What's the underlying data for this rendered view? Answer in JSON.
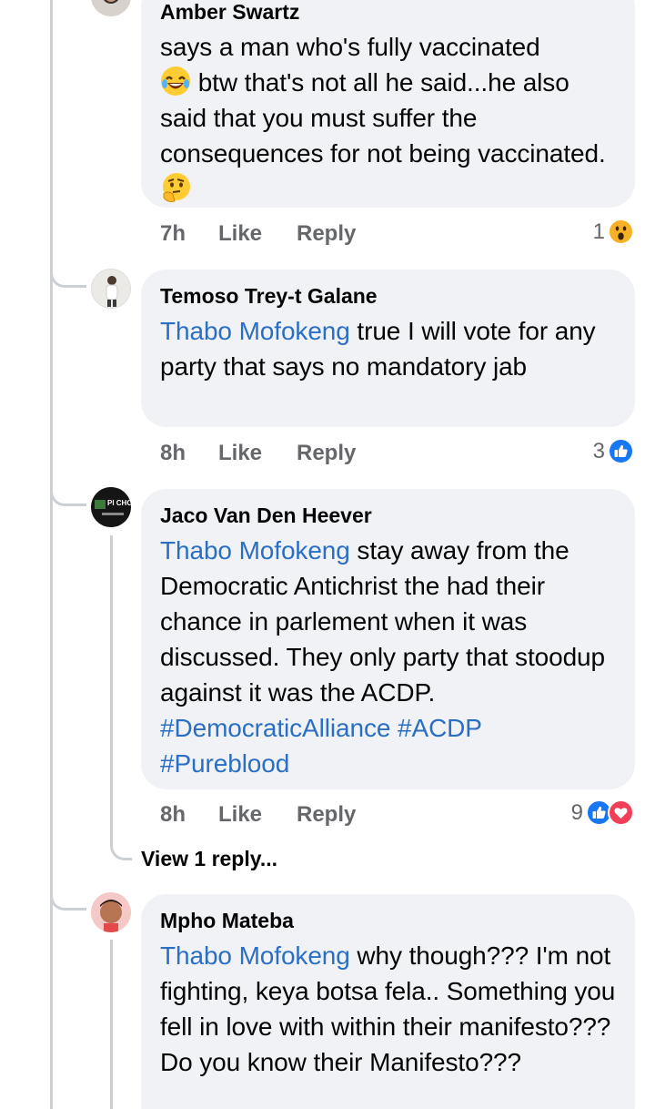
{
  "comments": [
    {
      "author": "Amber Swartz",
      "text_parts": [
        "says a man who's fully vaccinated",
        "btw that's not all he said...he also said that you must suffer the consequences for not being vaccinated."
      ],
      "time": "7h",
      "like_label": "Like",
      "reply_label": "Reply",
      "reaction_count": "1",
      "reactions": [
        "wow-icon"
      ]
    },
    {
      "author": "Temoso Trey-t Galane",
      "mention": "Thabo Mofokeng",
      "text": " true I will vote for any party that says no mandatory jab",
      "time": "8h",
      "like_label": "Like",
      "reply_label": "Reply",
      "reaction_count": "3",
      "reactions": [
        "like-icon"
      ]
    },
    {
      "author": "Jaco Van Den Heever",
      "mention": "Thabo Mofokeng",
      "text": " stay away from the Democratic Antichrist the had their chance in parlement when it was discussed. They only party that stoodup against it was the ACDP.",
      "hashtags": [
        "#DemocraticAlliance",
        "#ACDP",
        "#Pureblood"
      ],
      "time": "8h",
      "like_label": "Like",
      "reply_label": "Reply",
      "reaction_count": "9",
      "reactions": [
        "like-icon",
        "love-icon"
      ],
      "view_replies": "View 1 reply..."
    },
    {
      "author": "Mpho Mateba",
      "mention": "Thabo Mofokeng",
      "text": " why though??? I'm not fighting, keya botsa fela.. Something you fell in love with within their manifesto??? Do you know their Manifesto???"
    }
  ],
  "avatar_text": "PI CHOI",
  "colors": {
    "bubble": "#f0f2f5",
    "link": "#2b6fc4",
    "meta": "#65676b",
    "like": "#1877f2",
    "love": "#f33e58"
  }
}
